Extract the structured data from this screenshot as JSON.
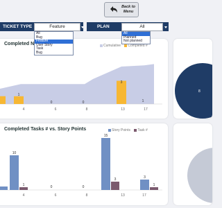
{
  "back_button": {
    "label_line1": "Back to",
    "label_line2": "Menu"
  },
  "filters": {
    "ticket_type": {
      "label": "TICKET TYPE",
      "selected": "Feature",
      "options": [
        "All",
        "Bug",
        "Feature",
        "User Story",
        "Task",
        "Bug"
      ]
    },
    "plan": {
      "label": "PLAN",
      "selected": "All",
      "options": [
        "All",
        "Planned",
        "Not planned"
      ]
    }
  },
  "chart1": {
    "title": "Completed N",
    "legend": [
      "Cumulative",
      "Completed #"
    ]
  },
  "chart2": {
    "title": "Completed Tasks # vs. Story Points",
    "legend": [
      "Story Points",
      "Task #"
    ]
  },
  "donut": {
    "value_label": "8"
  },
  "colors": {
    "navy": "#1f3c66",
    "area": "#c8cde6",
    "gold": "#f7b733",
    "story": "#7090c4",
    "task": "#7b5a6e"
  },
  "chart_data": [
    {
      "type": "bar",
      "title": "Completed N",
      "categories": [
        "",
        "4",
        "6",
        "8",
        "10",
        "13",
        "15",
        "17"
      ],
      "series": [
        {
          "name": "Cumulative",
          "type": "area",
          "values": [
            1.2,
            1.6,
            1.6,
            1.6,
            2.0,
            3.0,
            3.1,
            3.2
          ]
        },
        {
          "name": "Completed #",
          "values": [
            0,
            1,
            0,
            0,
            0,
            3,
            1,
            1
          ]
        }
      ],
      "data_labels": [
        "",
        "1",
        "0",
        "0",
        "0",
        "3",
        "1",
        "1"
      ],
      "ylim": [
        0,
        4
      ]
    },
    {
      "type": "bar",
      "title": "Completed Tasks # vs. Story Points",
      "categories": [
        "",
        "4",
        "6",
        "8",
        "10",
        "13",
        "15",
        "17"
      ],
      "series": [
        {
          "name": "Story Points",
          "values": [
            1,
            10,
            0,
            0,
            0,
            15,
            1,
            3
          ]
        },
        {
          "name": "Task #",
          "values": [
            null,
            1,
            0,
            0,
            0,
            3,
            null,
            1
          ]
        }
      ],
      "story_labels": [
        "",
        "10",
        "0",
        "0",
        "0",
        "15",
        "",
        "3"
      ],
      "task_labels": [
        "",
        "1",
        "0",
        "0",
        "0",
        "3",
        "",
        "1"
      ],
      "ylim": [
        0,
        16
      ]
    }
  ]
}
